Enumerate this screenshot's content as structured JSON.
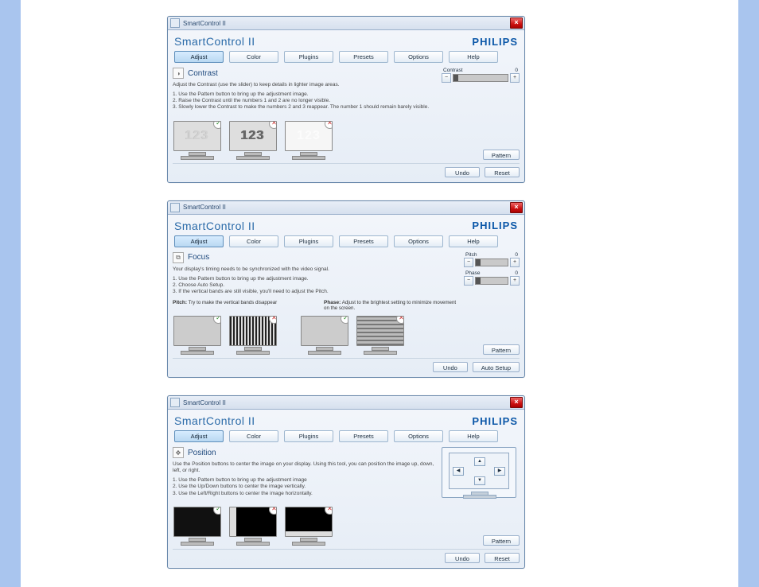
{
  "app": {
    "title": "SmartControl II",
    "product": "SmartControl II",
    "brand": "PHILIPS",
    "close_icon": "×"
  },
  "tabs": {
    "adjust": "Adjust",
    "color": "Color",
    "plugins": "Plugins",
    "presets": "Presets",
    "options": "Options",
    "help": "Help"
  },
  "panels": {
    "contrast": {
      "icon": "◑",
      "title": "Contrast",
      "desc": "Adjust the Contrast (use the slider) to keep details in lighter image areas.",
      "steps": [
        "1. Use the Pattern button to bring up the adjustment image.",
        "2. Raise the Contrast until the numbers 1 and 2 are no longer visible.",
        "3. Slowly lower the Contrast to make the numbers 2 and 3 reappear. The number 1 should remain barely visible."
      ],
      "slider": {
        "label": "Contrast",
        "value": 0
      },
      "monitors": [
        {
          "status": "ok",
          "content": "123-faint"
        },
        {
          "status": "bad",
          "content": "123-dark"
        },
        {
          "status": "bad",
          "content": "123-white"
        }
      ],
      "pattern_btn": "Pattern",
      "undo_btn": "Undo",
      "reset_btn": "Reset"
    },
    "focus": {
      "icon": "⧉",
      "title": "Focus",
      "desc": "Your display's timing needs to be synchronized with the video signal.",
      "steps": [
        "1. Use the Pattern button to bring up the adjustment image.",
        "2. Choose Auto Setup.",
        "3. If the vertical bands are still visible, you'll need to adjust the Pitch."
      ],
      "pitch": {
        "label": "Pitch",
        "value": 0
      },
      "phase": {
        "label": "Phase",
        "value": 0
      },
      "pitch_text_label": "Pitch:",
      "pitch_text": "Try to make the vertical bands disappear",
      "phase_text_label": "Phase:",
      "phase_text": "Adjust to the brightest setting to minimize movement on the screen.",
      "monitors_a": [
        {
          "status": "ok",
          "content": "solid"
        },
        {
          "status": "bad",
          "content": "vbands"
        }
      ],
      "monitors_b": [
        {
          "status": "ok",
          "content": "solid"
        },
        {
          "status": "bad",
          "content": "hlines"
        }
      ],
      "pattern_btn": "Pattern",
      "undo_btn": "Undo",
      "autosetup_btn": "Auto Setup"
    },
    "position": {
      "icon": "✥",
      "title": "Position",
      "desc": "Use the Position buttons to center the image on your display. Using this tool, you can position the image up, down, left, or right.",
      "steps": [
        "1. Use the Pattern button to bring up the adjustment image",
        "2. Use the Up/Down buttons to center the image vertically.",
        "3. Use the Left/Right buttons to center the image horizontally."
      ],
      "arrows": {
        "up": "▲",
        "down": "▼",
        "left": "◀",
        "right": "▶"
      },
      "monitors": [
        {
          "status": "ok",
          "content": "black"
        },
        {
          "status": "bad",
          "content": "black-shift-r"
        },
        {
          "status": "bad",
          "content": "black-shift-u"
        }
      ],
      "pattern_btn": "Pattern",
      "undo_btn": "Undo",
      "reset_btn": "Reset"
    }
  }
}
